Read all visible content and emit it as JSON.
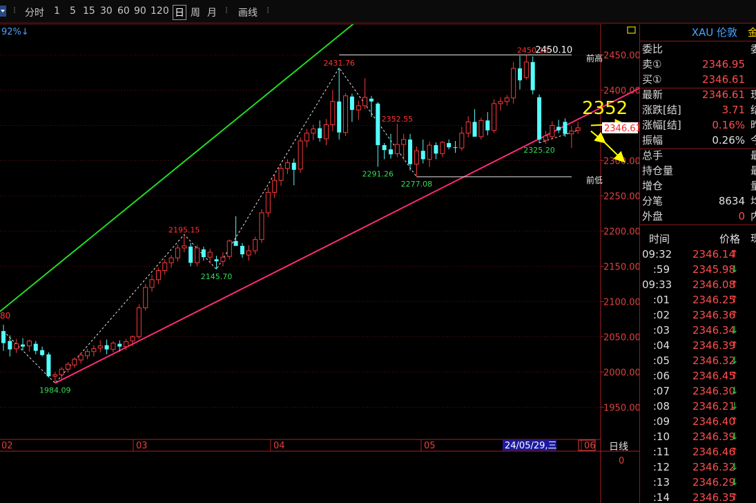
{
  "toolbar": {
    "items": [
      "分时",
      "1",
      "5",
      "15",
      "30",
      "60",
      "90",
      "120",
      "日",
      "周",
      "月",
      "画线"
    ],
    "active": "日"
  },
  "chart_data": {
    "type": "candlestick",
    "period": "日线",
    "x_tick_labels": [
      "02",
      "03",
      "04",
      "05",
      "06"
    ],
    "cursor_date_label": "24/05/29,三",
    "ylim": [
      1915,
      2480
    ],
    "y_ticks": [
      1950,
      2000,
      2050,
      2100,
      2150,
      2200,
      2250,
      2300,
      2350,
      2400,
      2450
    ],
    "y_tick_labels": [
      "1950.00",
      "2000.00",
      "2050.00",
      "2100.00",
      "2150.00",
      "2200.00",
      "2250.00",
      "2300.00",
      "2350.00",
      "2400.00",
      "2450.00"
    ],
    "current_price_label": "2346.61",
    "current_price": 2346.61,
    "top_left_label": "92%↓",
    "left_edge_label": "80",
    "volume_axis_label": "日线",
    "volume_axis_value": "0",
    "annotation_big": "2352",
    "candles": [
      {
        "o": 2058,
        "h": 2067,
        "l": 2030,
        "c": 2041
      },
      {
        "o": 2044,
        "h": 2052,
        "l": 2022,
        "c": 2032
      },
      {
        "o": 2033,
        "h": 2047,
        "l": 2027,
        "c": 2040
      },
      {
        "o": 2039,
        "h": 2048,
        "l": 2031,
        "c": 2036
      },
      {
        "o": 2037,
        "h": 2046,
        "l": 2029,
        "c": 2044
      },
      {
        "o": 2040,
        "h": 2044,
        "l": 2025,
        "c": 2030
      },
      {
        "o": 2031,
        "h": 2036,
        "l": 2022,
        "c": 2024
      },
      {
        "o": 2025,
        "h": 2028,
        "l": 1992,
        "c": 1994
      },
      {
        "o": 1994,
        "h": 2000,
        "l": 1984.09,
        "c": 1996
      },
      {
        "o": 1996,
        "h": 2007,
        "l": 1990,
        "c": 2004
      },
      {
        "o": 2004,
        "h": 2014,
        "l": 1999,
        "c": 2011
      },
      {
        "o": 2010,
        "h": 2021,
        "l": 2006,
        "c": 2018
      },
      {
        "o": 2017,
        "h": 2027,
        "l": 2012,
        "c": 2024
      },
      {
        "o": 2023,
        "h": 2033,
        "l": 2018,
        "c": 2029
      },
      {
        "o": 2029,
        "h": 2038,
        "l": 2022,
        "c": 2033
      },
      {
        "o": 2034,
        "h": 2045,
        "l": 2028,
        "c": 2037
      },
      {
        "o": 2038,
        "h": 2046,
        "l": 2025,
        "c": 2032
      },
      {
        "o": 2032,
        "h": 2044,
        "l": 2028,
        "c": 2041
      },
      {
        "o": 2040,
        "h": 2045,
        "l": 2029,
        "c": 2036
      },
      {
        "o": 2036,
        "h": 2047,
        "l": 2031,
        "c": 2043
      },
      {
        "o": 2044,
        "h": 2052,
        "l": 2037,
        "c": 2050
      },
      {
        "o": 2050,
        "h": 2096,
        "l": 2047,
        "c": 2091
      },
      {
        "o": 2091,
        "h": 2125,
        "l": 2087,
        "c": 2120
      },
      {
        "o": 2120,
        "h": 2138,
        "l": 2114,
        "c": 2131
      },
      {
        "o": 2131,
        "h": 2148,
        "l": 2125,
        "c": 2144
      },
      {
        "o": 2144,
        "h": 2160,
        "l": 2138,
        "c": 2155
      },
      {
        "o": 2155,
        "h": 2166,
        "l": 2148,
        "c": 2162
      },
      {
        "o": 2162,
        "h": 2181,
        "l": 2157,
        "c": 2176
      },
      {
        "o": 2176,
        "h": 2195.15,
        "l": 2170,
        "c": 2179
      },
      {
        "o": 2178,
        "h": 2183,
        "l": 2150,
        "c": 2155
      },
      {
        "o": 2155,
        "h": 2180,
        "l": 2150,
        "c": 2176
      },
      {
        "o": 2174,
        "h": 2178,
        "l": 2158,
        "c": 2163
      },
      {
        "o": 2163,
        "h": 2175,
        "l": 2154,
        "c": 2170
      },
      {
        "o": 2160,
        "h": 2165,
        "l": 2145.7,
        "c": 2157
      },
      {
        "o": 2157,
        "h": 2170,
        "l": 2150,
        "c": 2163
      },
      {
        "o": 2164,
        "h": 2188,
        "l": 2160,
        "c": 2186
      },
      {
        "o": 2186,
        "h": 2221,
        "l": 2181,
        "c": 2179
      },
      {
        "o": 2179,
        "h": 2183,
        "l": 2162,
        "c": 2167
      },
      {
        "o": 2166,
        "h": 2180,
        "l": 2158,
        "c": 2172
      },
      {
        "o": 2172,
        "h": 2192,
        "l": 2167,
        "c": 2188
      },
      {
        "o": 2188,
        "h": 2231,
        "l": 2183,
        "c": 2226
      },
      {
        "o": 2226,
        "h": 2262,
        "l": 2220,
        "c": 2255
      },
      {
        "o": 2255,
        "h": 2280,
        "l": 2247,
        "c": 2272
      },
      {
        "o": 2272,
        "h": 2294,
        "l": 2264,
        "c": 2289
      },
      {
        "o": 2289,
        "h": 2302,
        "l": 2281,
        "c": 2297
      },
      {
        "o": 2297,
        "h": 2303,
        "l": 2265,
        "c": 2287
      },
      {
        "o": 2288,
        "h": 2333,
        "l": 2283,
        "c": 2328
      },
      {
        "o": 2328,
        "h": 2345,
        "l": 2319,
        "c": 2339
      },
      {
        "o": 2339,
        "h": 2351,
        "l": 2329,
        "c": 2345
      },
      {
        "o": 2346,
        "h": 2357,
        "l": 2327,
        "c": 2332
      },
      {
        "o": 2331,
        "h": 2359,
        "l": 2322,
        "c": 2351
      },
      {
        "o": 2351,
        "h": 2400,
        "l": 2342,
        "c": 2384
      },
      {
        "o": 2384,
        "h": 2431.76,
        "l": 2330,
        "c": 2340
      },
      {
        "o": 2340,
        "h": 2396,
        "l": 2335,
        "c": 2392
      },
      {
        "o": 2391,
        "h": 2395,
        "l": 2355,
        "c": 2372
      },
      {
        "o": 2372,
        "h": 2385,
        "l": 2358,
        "c": 2378
      },
      {
        "o": 2378,
        "h": 2417,
        "l": 2373,
        "c": 2390
      },
      {
        "o": 2388,
        "h": 2392,
        "l": 2362,
        "c": 2384
      },
      {
        "o": 2381,
        "h": 2383,
        "l": 2291.26,
        "c": 2322
      },
      {
        "o": 2322,
        "h": 2325,
        "l": 2302,
        "c": 2315
      },
      {
        "o": 2316,
        "h": 2338,
        "l": 2303,
        "c": 2309
      },
      {
        "o": 2310,
        "h": 2352.55,
        "l": 2305,
        "c": 2323
      },
      {
        "o": 2323,
        "h": 2338,
        "l": 2301,
        "c": 2330
      },
      {
        "o": 2330,
        "h": 2338,
        "l": 2286,
        "c": 2295
      },
      {
        "o": 2295,
        "h": 2320,
        "l": 2277.08,
        "c": 2314
      },
      {
        "o": 2314,
        "h": 2330,
        "l": 2296,
        "c": 2302
      },
      {
        "o": 2302,
        "h": 2327,
        "l": 2291,
        "c": 2322
      },
      {
        "o": 2322,
        "h": 2326,
        "l": 2302,
        "c": 2310
      },
      {
        "o": 2310,
        "h": 2328,
        "l": 2305,
        "c": 2326
      },
      {
        "o": 2325,
        "h": 2330,
        "l": 2316,
        "c": 2319
      },
      {
        "o": 2319,
        "h": 2328,
        "l": 2311,
        "c": 2318
      },
      {
        "o": 2318,
        "h": 2348,
        "l": 2314,
        "c": 2339
      },
      {
        "o": 2339,
        "h": 2363,
        "l": 2333,
        "c": 2355
      },
      {
        "o": 2355,
        "h": 2373,
        "l": 2349,
        "c": 2334
      },
      {
        "o": 2334,
        "h": 2361,
        "l": 2330,
        "c": 2357
      },
      {
        "o": 2357,
        "h": 2369,
        "l": 2336,
        "c": 2343
      },
      {
        "o": 2343,
        "h": 2387,
        "l": 2339,
        "c": 2381
      },
      {
        "o": 2381,
        "h": 2390,
        "l": 2371,
        "c": 2384
      },
      {
        "o": 2384,
        "h": 2393,
        "l": 2378,
        "c": 2389
      },
      {
        "o": 2389,
        "h": 2440,
        "l": 2381,
        "c": 2431
      },
      {
        "o": 2431,
        "h": 2449,
        "l": 2401,
        "c": 2414
      },
      {
        "o": 2418,
        "h": 2450.1,
        "l": 2415,
        "c": 2440
      },
      {
        "o": 2440,
        "h": 2448,
        "l": 2394,
        "c": 2400
      },
      {
        "o": 2390,
        "h": 2394,
        "l": 2325.2,
        "c": 2330
      },
      {
        "o": 2329,
        "h": 2342,
        "l": 2324,
        "c": 2335
      },
      {
        "o": 2334,
        "h": 2356,
        "l": 2330,
        "c": 2350
      },
      {
        "o": 2348,
        "h": 2358,
        "l": 2339,
        "c": 2343
      },
      {
        "o": 2355,
        "h": 2360,
        "l": 2334,
        "c": 2338
      },
      {
        "o": 2338,
        "h": 2349,
        "l": 2318,
        "c": 2342
      },
      {
        "o": 2343,
        "h": 2355,
        "l": 2338,
        "c": 2346.61
      }
    ],
    "price_labels": [
      {
        "text": "1984.09",
        "color": "#33dd55",
        "anchor": 8,
        "price": 1984.09,
        "pos": "below"
      },
      {
        "text": "2195.15",
        "color": "#ff3333",
        "anchor": 28,
        "price": 2195.15,
        "pos": "above"
      },
      {
        "text": "2145.70",
        "color": "#33dd55",
        "anchor": 33,
        "price": 2145.7,
        "pos": "below"
      },
      {
        "text": "2431.76",
        "color": "#ff3333",
        "anchor": 52,
        "price": 2431.76,
        "pos": "above"
      },
      {
        "text": "2291.26",
        "color": "#33dd55",
        "anchor": 58,
        "price": 2291.26,
        "pos": "below"
      },
      {
        "text": "2352.55",
        "color": "#ff3333",
        "anchor": 61,
        "price": 2352.55,
        "pos": "above"
      },
      {
        "text": "2277.08",
        "color": "#33dd55",
        "anchor": 64,
        "price": 2277.08,
        "pos": "below"
      },
      {
        "text": "2450.10",
        "color": "#ff3333",
        "anchor": 82,
        "price": 2450.1,
        "pos": "above"
      },
      {
        "text": "2450.10",
        "color": "#ffffff",
        "anchor": 84,
        "price": 2450.1,
        "pos": "right"
      },
      {
        "text": "2325.20",
        "color": "#33dd55",
        "anchor": 83,
        "price": 2325.2,
        "pos": "below"
      }
    ],
    "hlines": [
      {
        "price": 2450.1,
        "from_index": 52,
        "label": "前高"
      },
      {
        "price": 2277.08,
        "from_index": 64,
        "label": "前低"
      }
    ],
    "trendlines": [
      {
        "color": "#22dd22",
        "from": {
          "i": -2,
          "p": 2075
        },
        "to": {
          "i": 57,
          "p": 2515
        }
      },
      {
        "color": "#ff2a7a",
        "from": {
          "i": 8,
          "p": 1984.09
        },
        "to": {
          "i": 99,
          "p": 2405
        }
      }
    ],
    "zigzag": [
      {
        "i": 0,
        "p": 2058
      },
      {
        "i": 8,
        "p": 1984.09
      },
      {
        "i": 28,
        "p": 2195.15
      },
      {
        "i": 33,
        "p": 2145.7
      },
      {
        "i": 52,
        "p": 2431.76
      },
      {
        "i": 64,
        "p": 2277.08
      }
    ],
    "zigzag2": [
      {
        "i": 83,
        "p": 2325.2
      },
      {
        "i": 89,
        "p": 2343
      }
    ],
    "arrows": [
      {
        "from": {
          "i": 91,
          "p": 2350
        },
        "to": {
          "i": 96,
          "p": 2352
        }
      },
      {
        "from": {
          "i": 91,
          "p": 2342
        },
        "to": {
          "i": 93,
          "p": 2327
        }
      },
      {
        "from": {
          "i": 93,
          "p": 2327
        },
        "to": {
          "i": 96,
          "p": 2300
        }
      }
    ]
  },
  "panel": {
    "title": "XAU 伦敦",
    "title_suffix": "金",
    "rows": [
      {
        "label": "委比",
        "value": "",
        "ext": "委",
        "color": "#d8d8d8"
      },
      {
        "label": "卖①",
        "value": "2346.95",
        "ext": "",
        "color": "#ff4d4d"
      },
      {
        "label": "买①",
        "value": "2346.61",
        "ext": "",
        "color": "#ff4d4d"
      },
      {
        "label": "最新",
        "value": "2346.61",
        "ext": "现",
        "color": "#ff4d4d"
      },
      {
        "label": "涨跌[结]",
        "value": "3.71",
        "ext": "结",
        "color": "#ff4d4d"
      },
      {
        "label": "涨幅[结]",
        "value": "0.16%",
        "ext": "昨",
        "color": "#ff4d4d"
      },
      {
        "label": "振幅",
        "value": "0.26%",
        "ext": "今",
        "color": "#e0e0e0"
      },
      {
        "label": "总手",
        "value": "",
        "ext": "最",
        "color": "#e0e0e0"
      },
      {
        "label": "持仓量",
        "value": "",
        "ext": "最",
        "color": "#e0e0e0"
      },
      {
        "label": "增仓",
        "value": "",
        "ext": "量",
        "color": "#e0e0e0"
      },
      {
        "label": "分笔",
        "value": "8634",
        "ext": "均",
        "color": "#e0e0e0"
      },
      {
        "label": "外盘",
        "value": "0",
        "ext": "内",
        "color": "#ff4d4d"
      }
    ],
    "ticks_header": {
      "time": "时间",
      "price": "价格",
      "ext": "现"
    },
    "ticks": [
      {
        "time": "09:32",
        "price": "2346.14",
        "dir": "up"
      },
      {
        "time": ":59",
        "price": "2345.98",
        "dir": "down"
      },
      {
        "time": "09:33",
        "price": "2346.08",
        "dir": "up"
      },
      {
        "time": ":01",
        "price": "2346.25",
        "dir": "up"
      },
      {
        "time": ":02",
        "price": "2346.36",
        "dir": "up"
      },
      {
        "time": ":03",
        "price": "2346.34",
        "dir": "down"
      },
      {
        "time": ":04",
        "price": "2346.39",
        "dir": "up"
      },
      {
        "time": ":05",
        "price": "2346.32",
        "dir": "down"
      },
      {
        "time": ":06",
        "price": "2346.45",
        "dir": "up"
      },
      {
        "time": ":07",
        "price": "2346.30",
        "dir": "down"
      },
      {
        "time": ":08",
        "price": "2346.21",
        "dir": "down"
      },
      {
        "time": ":09",
        "price": "2346.40",
        "dir": "up"
      },
      {
        "time": ":10",
        "price": "2346.39",
        "dir": "down"
      },
      {
        "time": ":11",
        "price": "2346.46",
        "dir": "up"
      },
      {
        "time": ":12",
        "price": "2346.32",
        "dir": "down"
      },
      {
        "time": ":13",
        "price": "2346.29",
        "dir": "down"
      },
      {
        "time": ":14",
        "price": "2346.35",
        "dir": "up"
      }
    ]
  }
}
